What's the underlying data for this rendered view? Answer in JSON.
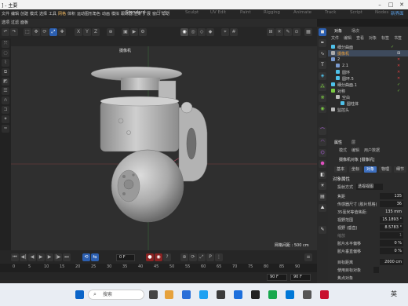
{
  "window": {
    "title": "] - 主要"
  },
  "menubar": {
    "items": [
      "文件",
      "编辑",
      "创建",
      "模式",
      "选择",
      "工具",
      "网格",
      "体积",
      "运动图形",
      "角色",
      "动画",
      "模拟",
      "跟踪器",
      "渲染",
      "扩展",
      "窗口",
      "帮助"
    ],
    "layout_tabs": [
      "Standard",
      "Model",
      "Sculpt",
      "UV Edit",
      "Paint",
      "Rigging",
      "Animate",
      "Track",
      "Script",
      "Nodes"
    ],
    "new_layouts_label": "新界面"
  },
  "submenu": {
    "items": [
      "选项",
      "过滤",
      "面板"
    ]
  },
  "viewport": {
    "camera_label": "摄像机",
    "grid_spacing": "网格间距 : 500 cm"
  },
  "timeline": {
    "current_frame": "0 F",
    "end_frame_1": "90 F",
    "end_frame_2": "90 F",
    "ruler_ticks": [
      "0",
      "5",
      "10",
      "15",
      "20",
      "25",
      "30",
      "35",
      "40",
      "45",
      "50",
      "55",
      "60",
      "65",
      "70",
      "75",
      "80",
      "85",
      "90"
    ]
  },
  "objects_panel": {
    "tabs": [
      "对象",
      "场次"
    ],
    "menu": [
      "文件",
      "编辑",
      "查看",
      "对象",
      "标签",
      "书签"
    ],
    "rows": [
      {
        "name": "细分曲面",
        "indent": 0
      },
      {
        "name": "摄像机",
        "indent": 0,
        "selected": true
      },
      {
        "name": "2",
        "indent": 0
      },
      {
        "name": "2.1",
        "indent": 1
      },
      {
        "name": "圆环",
        "indent": 1
      },
      {
        "name": "圆环.5",
        "indent": 1
      },
      {
        "name": "细分曲面.1",
        "indent": 0
      },
      {
        "name": "对称",
        "indent": 0
      },
      {
        "name": "空白",
        "indent": 1
      },
      {
        "name": "圆柱体",
        "indent": 2
      },
      {
        "name": "监控头",
        "indent": 0
      }
    ]
  },
  "attributes_panel": {
    "header_tabs": [
      "属性",
      "层"
    ],
    "menu": [
      "模式",
      "编辑",
      "用户数据"
    ],
    "object_title": "摄像机对象 [摄像机]",
    "tabs": [
      "基本",
      "坐标",
      "对象",
      "物理",
      "细节"
    ],
    "active_tab": "对象",
    "section_title": "对象属性",
    "rows": [
      {
        "label": "投射方式",
        "value": "透视视图"
      },
      {
        "label": "焦距",
        "value": "135"
      },
      {
        "label": "传感器尺寸 (胶片规格)",
        "value": "36"
      },
      {
        "label": "35毫米等值焦距:",
        "value": "135 mm"
      },
      {
        "label": "视野范围",
        "value": "15.1893 °"
      },
      {
        "label": "视野 (垂直)",
        "value": "8.5783 °"
      },
      {
        "label": "缩放",
        "value": "1"
      },
      {
        "label": "胶片水平偏移",
        "value": "0 %"
      },
      {
        "label": "胶片垂直偏移",
        "value": "0 %"
      },
      {
        "label": "目标距离",
        "value": "2000 cm"
      },
      {
        "label": "使用目标对象",
        "value": ""
      },
      {
        "label": "焦点对象",
        "value": ""
      }
    ]
  },
  "taskbar": {
    "search_placeholder": "搜索",
    "lang": "英"
  }
}
